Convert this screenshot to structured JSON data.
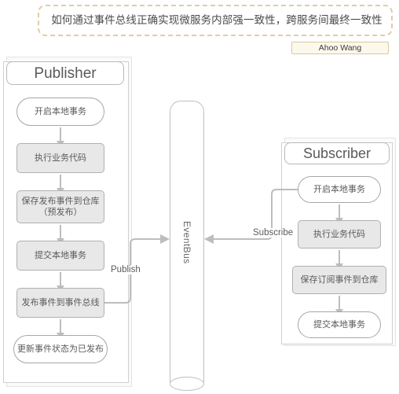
{
  "title": {
    "text": "如何通过事件总线正确实现微服务内部强一致性，跨服务间最终一致性"
  },
  "author": {
    "name": "Ahoo Wang"
  },
  "lanes": [
    {
      "id": "publisher",
      "title": "Publisher",
      "nodes": [
        {
          "label": "开启本地事务",
          "shape": "terminator"
        },
        {
          "label": "执行业务代码",
          "shape": "process"
        },
        {
          "label": "保存发布事件到仓库\n（预发布）",
          "shape": "process"
        },
        {
          "label": "提交本地事务",
          "shape": "process"
        },
        {
          "label": "发布事件到事件总线",
          "shape": "process"
        },
        {
          "label": "更新事件状态为已发布",
          "shape": "terminator"
        }
      ]
    },
    {
      "id": "subscriber",
      "title": "Subscriber",
      "nodes": [
        {
          "label": "开启本地事务",
          "shape": "terminator"
        },
        {
          "label": "执行业务代码",
          "shape": "process"
        },
        {
          "label": "保存订阅事件到仓库",
          "shape": "process"
        },
        {
          "label": "提交本地事务",
          "shape": "terminator"
        }
      ]
    }
  ],
  "eventbus": {
    "label": "EventBus"
  },
  "edges": {
    "publish": "Publish",
    "subscribe": "Subscribe"
  },
  "colors": {
    "process_fill": "#E8E8E8",
    "process_stroke": "#B0B0B0",
    "terminator_stroke": "#A6A6A6",
    "lane_stroke": "#CFCFCF",
    "arrow": "#BDBDBD",
    "banner_border": "#E0CDA9",
    "badge_fill": "#FDF8EC",
    "badge_border": "#D9C9A3",
    "text": "#5A5A5A"
  }
}
